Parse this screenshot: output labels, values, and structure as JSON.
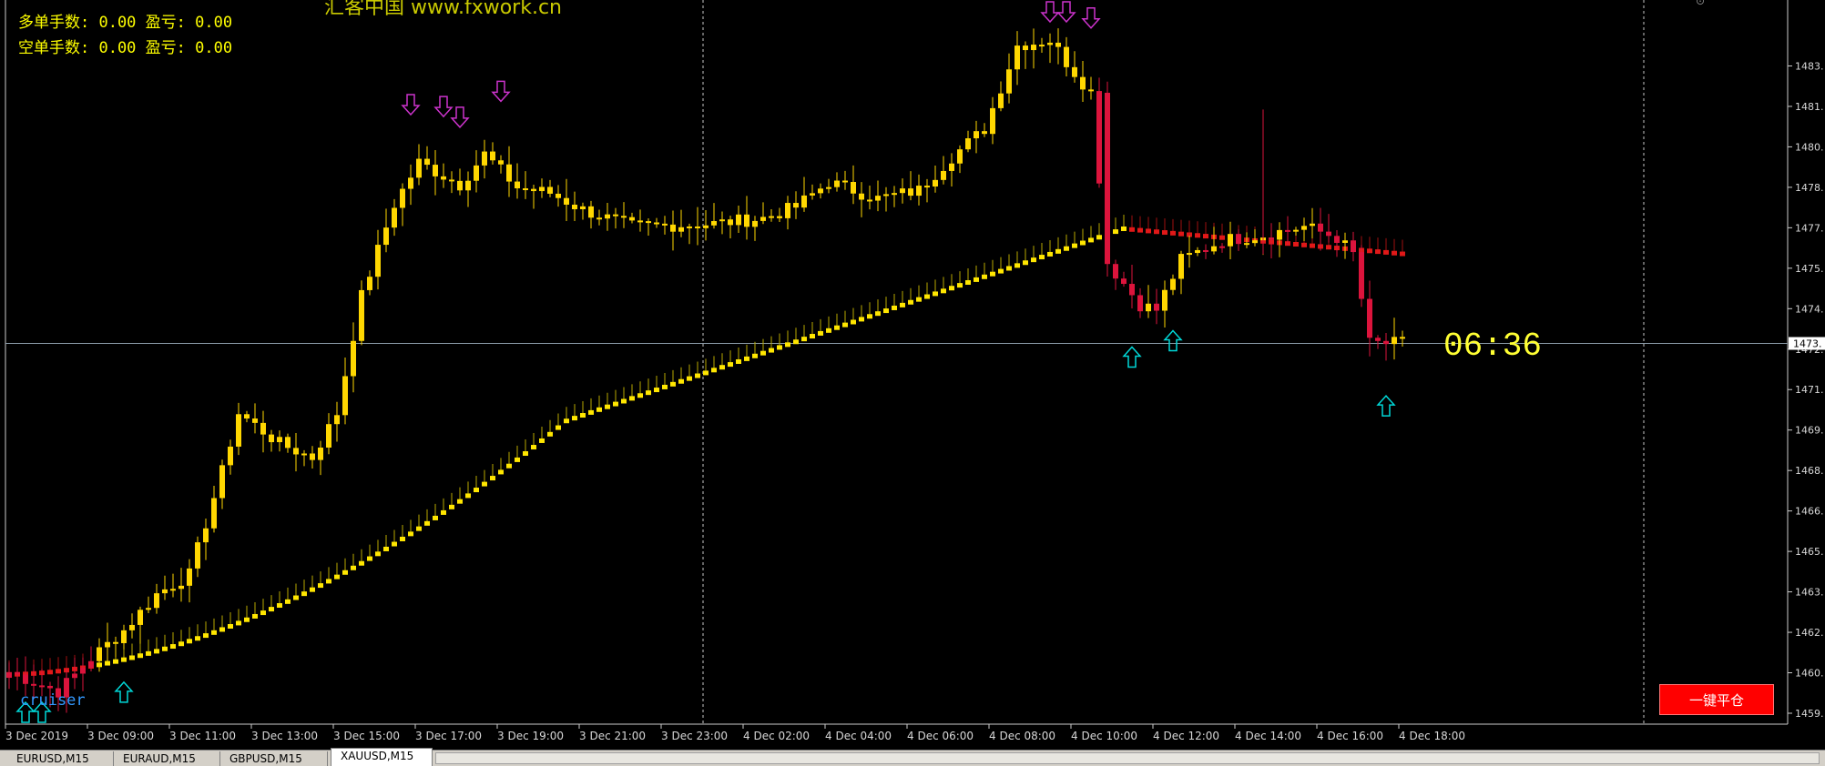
{
  "window": {
    "symbol": "XAUUSD",
    "timeframe": "M15"
  },
  "info": {
    "long_line": "多单手数: 0.00 盈亏: 0.00",
    "short_line": "空单手数: 0.00 盈亏: 0.00"
  },
  "watermark": "汇客中国 www.fxwork.cn",
  "indicator_label": "cruiser",
  "countdown": "06:36",
  "close_all_button": "一键平仓",
  "current_price_tag": "1473.",
  "tabs": [
    {
      "label": "EURUSD,M15",
      "active": false
    },
    {
      "label": "EURAUD,M15",
      "active": false
    },
    {
      "label": "GBPUSD,M15",
      "active": false
    },
    {
      "label": "XAUUSD,M15",
      "active": true
    }
  ],
  "colors": {
    "bull": "#ffd700",
    "bear": "#dc143c",
    "buy_arrow": "#00d8d8",
    "sell_arrow": "#cc33cc",
    "grid": "#6e6e6e",
    "price_line": "#8a9aa8"
  },
  "chart_data": {
    "type": "candlestick",
    "symbol": "XAUUSD",
    "timeframe": "M15",
    "ylim": [
      1459.0,
      1485.0
    ],
    "y_ticks": [
      "1459.",
      "1460.",
      "1462.",
      "1463.",
      "1465.",
      "1466.",
      "1468.",
      "1469.",
      "1471.",
      "1472.",
      "1474.",
      "1475.",
      "1477.",
      "1478.",
      "1480.",
      "1481.",
      "1483."
    ],
    "x_ticks": [
      "3 Dec 2019",
      "3 Dec 09:00",
      "3 Dec 11:00",
      "3 Dec 13:00",
      "3 Dec 15:00",
      "3 Dec 17:00",
      "3 Dec 19:00",
      "3 Dec 21:00",
      "3 Dec 23:00",
      "4 Dec 02:00",
      "4 Dec 04:00",
      "4 Dec 06:00",
      "4 Dec 08:00",
      "4 Dec 10:00",
      "4 Dec 12:00",
      "4 Dec 14:00",
      "4 Dec 16:00",
      "4 Dec 18:00"
    ],
    "current_price": 1472.8,
    "anchors": [
      [
        0,
        1461.0
      ],
      [
        6,
        1460.3
      ],
      [
        10,
        1461.5
      ],
      [
        14,
        1462.5
      ],
      [
        18,
        1463.8
      ],
      [
        22,
        1464.5
      ],
      [
        26,
        1468.2
      ],
      [
        28,
        1470.3
      ],
      [
        33,
        1469.2
      ],
      [
        37,
        1468.7
      ],
      [
        40,
        1470.3
      ],
      [
        43,
        1474.5
      ],
      [
        47,
        1477.8
      ],
      [
        50,
        1479.3
      ],
      [
        55,
        1478.5
      ],
      [
        58,
        1479.6
      ],
      [
        62,
        1478.4
      ],
      [
        66,
        1478.2
      ],
      [
        70,
        1477.6
      ],
      [
        76,
        1477.0
      ],
      [
        86,
        1477.1
      ],
      [
        92,
        1477.3
      ],
      [
        96,
        1477.7
      ],
      [
        100,
        1478.6
      ],
      [
        106,
        1478.0
      ],
      [
        111,
        1478.3
      ],
      [
        115,
        1479.5
      ],
      [
        119,
        1480.5
      ],
      [
        123,
        1483.5
      ],
      [
        127,
        1483.7
      ],
      [
        129,
        1482.9
      ],
      [
        132,
        1481.8
      ],
      [
        134,
        1475.7
      ],
      [
        138,
        1474.2
      ],
      [
        140,
        1474.0
      ],
      [
        143,
        1475.8
      ],
      [
        148,
        1476.5
      ],
      [
        153,
        1476.7
      ],
      [
        158,
        1477.0
      ],
      [
        162,
        1476.6
      ],
      [
        164,
        1476.0
      ],
      [
        166,
        1472.8
      ],
      [
        170,
        1472.8
      ]
    ],
    "moving_average": {
      "start": 1460.9,
      "mid": 1470.0,
      "peak_bar": 136,
      "peak": 1476.9,
      "end": 1476.0
    },
    "buy_signals": [
      2,
      4,
      14,
      137,
      142,
      168
    ],
    "sell_signals": [
      49,
      53,
      55,
      60,
      127,
      129,
      132
    ]
  }
}
